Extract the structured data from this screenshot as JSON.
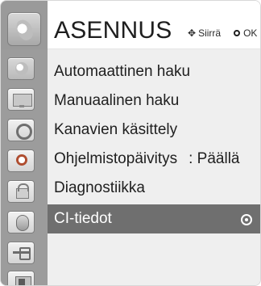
{
  "menu": {
    "title": "ASENNUS",
    "hints": {
      "move_label": "Siirrä",
      "ok_label": "OK"
    },
    "items": [
      {
        "label": "Automaattinen haku",
        "value": ""
      },
      {
        "label": "Manuaalinen haku",
        "value": ""
      },
      {
        "label": "Kanavien käsittely",
        "value": ""
      },
      {
        "label": "Ohjelmistopäivitys",
        "value": ": Päällä"
      },
      {
        "label": "Diagnostiikka",
        "value": ""
      },
      {
        "label": "CI-tiedot",
        "value": ""
      }
    ],
    "active_index": 5
  },
  "sidebar": {
    "categories": [
      {
        "icon": "setup-icon"
      },
      {
        "icon": "picture-icon"
      },
      {
        "icon": "audio-icon"
      },
      {
        "icon": "time-icon"
      },
      {
        "icon": "lock-icon"
      },
      {
        "icon": "option-icon"
      },
      {
        "icon": "input-icon"
      },
      {
        "icon": "usb-icon"
      }
    ]
  }
}
